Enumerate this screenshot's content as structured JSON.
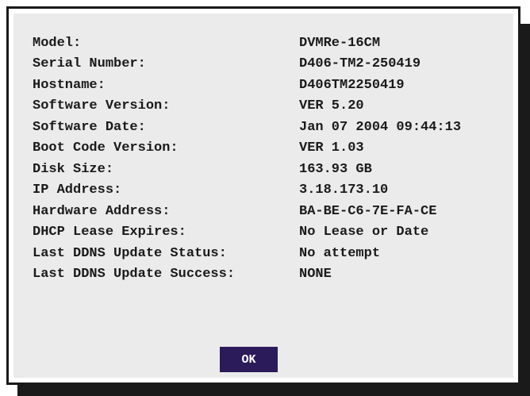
{
  "system_info": {
    "rows": [
      {
        "label": "Model:",
        "value": "DVMRe-16CM"
      },
      {
        "label": "Serial Number:",
        "value": "D406-TM2-250419"
      },
      {
        "label": "Hostname:",
        "value": "D406TM2250419"
      },
      {
        "label": "Software Version:",
        "value": "VER 5.20"
      },
      {
        "label": "Software Date:",
        "value": "Jan 07 2004 09:44:13"
      },
      {
        "label": "Boot Code Version:",
        "value": "VER 1.03"
      },
      {
        "label": "Disk Size:",
        "value": "163.93 GB"
      },
      {
        "label": "IP Address:",
        "value": "3.18.173.10"
      },
      {
        "label": "Hardware Address:",
        "value": "BA-BE-C6-7E-FA-CE"
      },
      {
        "label": "DHCP Lease Expires:",
        "value": "No Lease or Date"
      },
      {
        "label": "Last DDNS Update Status:",
        "value": "No attempt"
      },
      {
        "label": "Last DDNS Update Success:",
        "value": "NONE"
      }
    ]
  },
  "dialog": {
    "ok_label": "OK"
  },
  "colors": {
    "panel_background": "#ebebeb",
    "border": "#1a1a1a",
    "text": "#1a1a1a",
    "button_background": "#2b1b5a",
    "button_text": "#ffffff"
  }
}
